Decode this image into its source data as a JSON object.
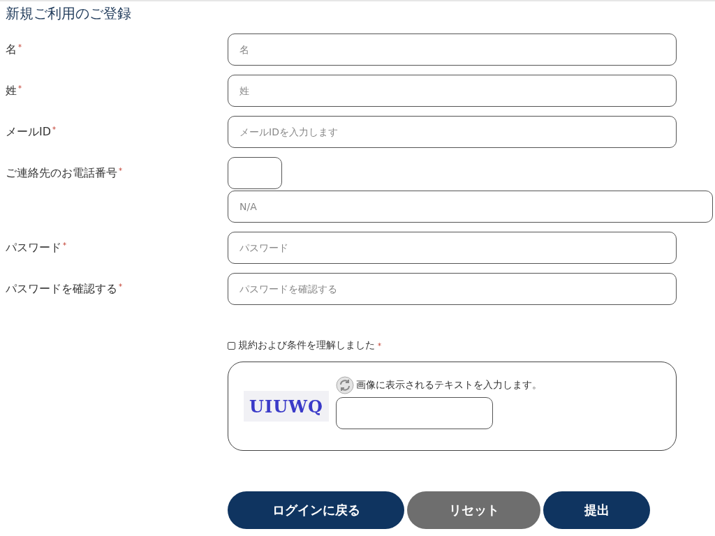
{
  "title": "新規ご利用のご登録",
  "fields": [
    {
      "kind": "text",
      "label": "名",
      "mark": "*",
      "placeholder": "名"
    },
    {
      "kind": "text",
      "label": "姓",
      "mark": "*",
      "placeholder": "姓"
    },
    {
      "kind": "text",
      "label": "メールID",
      "mark": "*",
      "placeholder": "メールIDを入力します"
    },
    {
      "kind": "phone",
      "label": "ご連絡先のお電話番号",
      "mark": "*",
      "placeholder": "N/A"
    },
    {
      "kind": "password",
      "label": "パスワード",
      "mark": "*",
      "placeholder": "パスワード"
    },
    {
      "kind": "password",
      "label": "パスワードを確認する",
      "mark": "*",
      "placeholder": "パスワードを確認する"
    }
  ],
  "terms": {
    "label": "規約および条件を理解しました",
    "mark": "*",
    "checked": false
  },
  "captcha": {
    "text": "UIUWQ",
    "prompt": "画像に表示されるテキストを入力します。"
  },
  "buttons": [
    {
      "label": "ログインに戻る",
      "kind": "primary"
    },
    {
      "label": "リセット",
      "kind": "secondary"
    },
    {
      "label": "提出",
      "kind": "primary"
    }
  ]
}
